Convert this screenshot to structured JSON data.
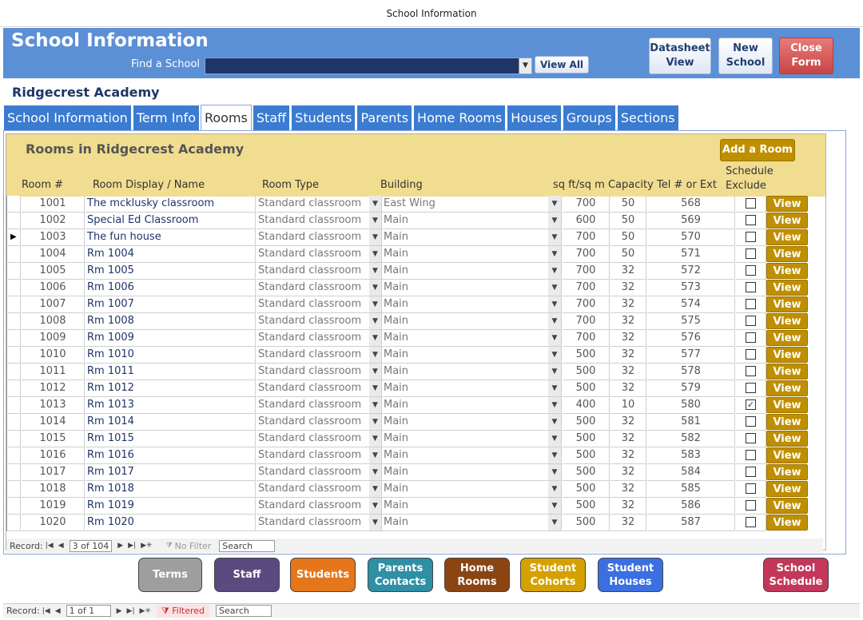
{
  "window": {
    "title": "School Information"
  },
  "header": {
    "title": "School Information",
    "find_label": "Find a School",
    "find_value": "",
    "view_all": "View All",
    "datasheet_line1": "Datasheet",
    "datasheet_line2": "View",
    "new_line1": "New",
    "new_line2": "School",
    "close_line1": "Close",
    "close_line2": "Form"
  },
  "school_name": "Ridgecrest Academy",
  "tabs": [
    {
      "label": "School Information",
      "active": false
    },
    {
      "label": "Term Info",
      "active": false
    },
    {
      "label": "Rooms",
      "active": true
    },
    {
      "label": "Staff",
      "active": false
    },
    {
      "label": "Students",
      "active": false
    },
    {
      "label": "Parents",
      "active": false
    },
    {
      "label": "Home Rooms",
      "active": false
    },
    {
      "label": "Houses",
      "active": false
    },
    {
      "label": "Groups",
      "active": false
    },
    {
      "label": "Sections",
      "active": false
    }
  ],
  "rooms": {
    "title": "Rooms in Ridgecrest Academy",
    "add_button": "Add a Room",
    "columns": {
      "num": "Room #",
      "name": "Room Display / Name",
      "type": "Room Type",
      "building": "Building",
      "sq": "sq ft/sq m",
      "capacity": "Capacity",
      "tel": "Tel # or Ext",
      "sched_line1": "Schedule",
      "sched_line2": "Exclude"
    },
    "view_label": "View",
    "current_row": 2,
    "rows": [
      {
        "num": "1001",
        "name": "The mcklusky classroom",
        "type": "Standard classroom",
        "building": "East Wing",
        "sq": "700",
        "cap": "50",
        "tel": "568",
        "excluded": false
      },
      {
        "num": "1002",
        "name": "Special Ed Classroom",
        "type": "Standard classroom",
        "building": "Main",
        "sq": "600",
        "cap": "50",
        "tel": "569",
        "excluded": false
      },
      {
        "num": "1003",
        "name": "The fun house",
        "type": "Standard classroom",
        "building": "Main",
        "sq": "700",
        "cap": "50",
        "tel": "570",
        "excluded": false
      },
      {
        "num": "1004",
        "name": "Rm 1004",
        "type": "Standard classroom",
        "building": "Main",
        "sq": "700",
        "cap": "50",
        "tel": "571",
        "excluded": false
      },
      {
        "num": "1005",
        "name": "Rm 1005",
        "type": "Standard classroom",
        "building": "Main",
        "sq": "700",
        "cap": "32",
        "tel": "572",
        "excluded": false
      },
      {
        "num": "1006",
        "name": "Rm 1006",
        "type": "Standard classroom",
        "building": "Main",
        "sq": "700",
        "cap": "32",
        "tel": "573",
        "excluded": false
      },
      {
        "num": "1007",
        "name": "Rm 1007",
        "type": "Standard classroom",
        "building": "Main",
        "sq": "700",
        "cap": "32",
        "tel": "574",
        "excluded": false
      },
      {
        "num": "1008",
        "name": "Rm 1008",
        "type": "Standard classroom",
        "building": "Main",
        "sq": "700",
        "cap": "32",
        "tel": "575",
        "excluded": false
      },
      {
        "num": "1009",
        "name": "Rm 1009",
        "type": "Standard classroom",
        "building": "Main",
        "sq": "700",
        "cap": "32",
        "tel": "576",
        "excluded": false
      },
      {
        "num": "1010",
        "name": "Rm 1010",
        "type": "Standard classroom",
        "building": "Main",
        "sq": "500",
        "cap": "32",
        "tel": "577",
        "excluded": false
      },
      {
        "num": "1011",
        "name": "Rm 1011",
        "type": "Standard classroom",
        "building": "Main",
        "sq": "500",
        "cap": "32",
        "tel": "578",
        "excluded": false
      },
      {
        "num": "1012",
        "name": "Rm 1012",
        "type": "Standard classroom",
        "building": "Main",
        "sq": "500",
        "cap": "32",
        "tel": "579",
        "excluded": false
      },
      {
        "num": "1013",
        "name": "Rm 1013",
        "type": "Standard classroom",
        "building": "Main",
        "sq": "400",
        "cap": "10",
        "tel": "580",
        "excluded": true
      },
      {
        "num": "1014",
        "name": "Rm 1014",
        "type": "Standard classroom",
        "building": "Main",
        "sq": "500",
        "cap": "32",
        "tel": "581",
        "excluded": false
      },
      {
        "num": "1015",
        "name": "Rm 1015",
        "type": "Standard classroom",
        "building": "Main",
        "sq": "500",
        "cap": "32",
        "tel": "582",
        "excluded": false
      },
      {
        "num": "1016",
        "name": "Rm 1016",
        "type": "Standard classroom",
        "building": "Main",
        "sq": "500",
        "cap": "32",
        "tel": "583",
        "excluded": false
      },
      {
        "num": "1017",
        "name": "Rm 1017",
        "type": "Standard classroom",
        "building": "Main",
        "sq": "500",
        "cap": "32",
        "tel": "584",
        "excluded": false
      },
      {
        "num": "1018",
        "name": "Rm 1018",
        "type": "Standard classroom",
        "building": "Main",
        "sq": "500",
        "cap": "32",
        "tel": "585",
        "excluded": false
      },
      {
        "num": "1019",
        "name": "Rm 1019",
        "type": "Standard classroom",
        "building": "Main",
        "sq": "500",
        "cap": "32",
        "tel": "586",
        "excluded": false
      },
      {
        "num": "1020",
        "name": "Rm 1020",
        "type": "Standard classroom",
        "building": "Main",
        "sq": "500",
        "cap": "32",
        "tel": "587",
        "excluded": false
      }
    ]
  },
  "subnav": {
    "record_label": "Record:",
    "position": "3 of 104",
    "filter": "No Filter",
    "search": "Search"
  },
  "mainnav": {
    "record_label": "Record:",
    "position": "1 of 1",
    "filter": "Filtered",
    "search": "Search"
  },
  "bottom_buttons": [
    {
      "l1": "Terms",
      "l2": "",
      "color": "#9e9e9e"
    },
    {
      "l1": "Staff",
      "l2": "",
      "color": "#5a4a7f"
    },
    {
      "l1": "Students",
      "l2": "",
      "color": "#e5761a"
    },
    {
      "l1": "Parents",
      "l2": "Contacts",
      "color": "#2e8fa5"
    },
    {
      "l1": "Home",
      "l2": "Rooms",
      "color": "#8b4513"
    },
    {
      "l1": "Student",
      "l2": "Cohorts",
      "color": "#d4a100"
    },
    {
      "l1": "Student",
      "l2": "Houses",
      "color": "#3c6fe0"
    },
    {
      "l1": "School",
      "l2": "Schedule",
      "color": "#c2375a"
    }
  ]
}
